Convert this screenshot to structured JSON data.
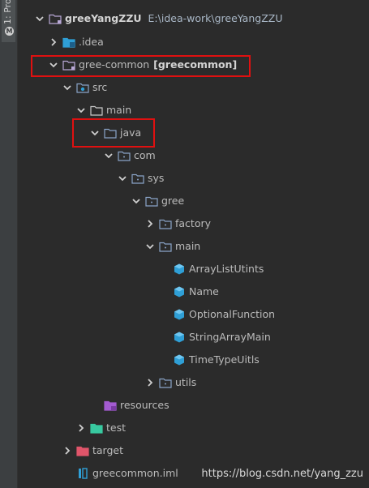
{
  "tool_window": {
    "tab_label": "1: Pro",
    "tab_icon": "project-icon"
  },
  "tree": [
    {
      "key": "root",
      "label": "greeYangZZU",
      "path": "E:\\idea-work\\greeYangZZU",
      "icon": "folder-module-icon",
      "expanded": true,
      "bold": true
    },
    {
      "key": "idea",
      "label": ".idea",
      "icon": "folder-idea-icon",
      "expanded": false
    },
    {
      "key": "gree_common",
      "label": "gree-common",
      "module": "[greecommon]",
      "icon": "folder-module-icon",
      "expanded": true
    },
    {
      "key": "src",
      "label": "src",
      "icon": "folder-src-icon",
      "expanded": true
    },
    {
      "key": "main",
      "label": "main",
      "icon": "folder-icon",
      "expanded": true
    },
    {
      "key": "java",
      "label": "java",
      "icon": "folder-source-root-icon",
      "expanded": true
    },
    {
      "key": "com",
      "label": "com",
      "icon": "package-icon",
      "expanded": true
    },
    {
      "key": "sys",
      "label": "sys",
      "icon": "package-icon",
      "expanded": true
    },
    {
      "key": "gree",
      "label": "gree",
      "icon": "package-icon",
      "expanded": true
    },
    {
      "key": "factory",
      "label": "factory",
      "icon": "package-icon",
      "expanded": false
    },
    {
      "key": "main_pkg",
      "label": "main",
      "icon": "package-icon",
      "expanded": true
    },
    {
      "key": "c1",
      "label": "ArrayListUtints",
      "icon": "java-class-icon"
    },
    {
      "key": "c2",
      "label": "Name",
      "icon": "java-class-icon"
    },
    {
      "key": "c3",
      "label": "OptionalFunction",
      "icon": "java-class-icon"
    },
    {
      "key": "c4",
      "label": "StringArrayMain",
      "icon": "java-class-icon"
    },
    {
      "key": "c5",
      "label": "TimeTypeUitls",
      "icon": "java-class-icon"
    },
    {
      "key": "utils",
      "label": "utils",
      "icon": "package-icon",
      "expanded": false
    },
    {
      "key": "resources",
      "label": "resources",
      "icon": "folder-resources-icon"
    },
    {
      "key": "test",
      "label": "test",
      "icon": "folder-test-icon",
      "expanded": false
    },
    {
      "key": "target",
      "label": "target",
      "icon": "folder-excluded-icon",
      "expanded": false
    },
    {
      "key": "iml",
      "label": "greecommon.iml",
      "icon": "iml-file-icon"
    }
  ],
  "watermark": "https://blog.csdn.net/yang_zzu",
  "colors": {
    "background": "#2b2b2b",
    "highlight_box": "#e01010",
    "folder": "#8aa4c8",
    "module_folder": "#b9a8d6",
    "class": "#2f9fd6",
    "resources": "#a35bd1",
    "test": "#38c9a0",
    "excluded": "#e0556a"
  }
}
